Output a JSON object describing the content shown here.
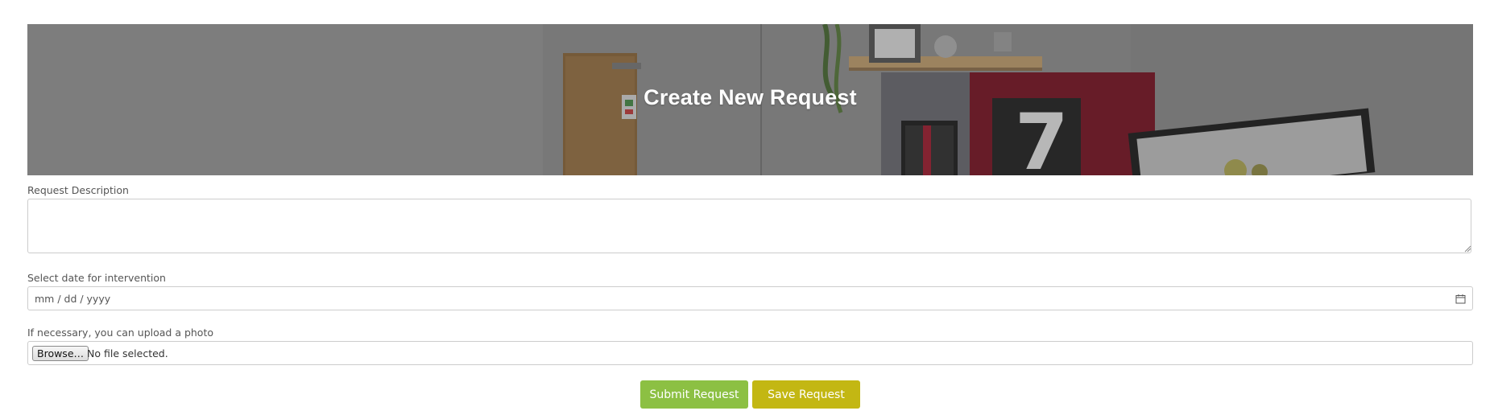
{
  "hero": {
    "title": "Create New Request"
  },
  "form": {
    "description": {
      "label": "Request Description",
      "value": ""
    },
    "date": {
      "label": "Select date for intervention",
      "placeholder": "mm / dd / yyyy"
    },
    "photo": {
      "label": "If necessary, you can upload a photo",
      "browse_label": "Browse…",
      "status": "No file selected."
    }
  },
  "actions": {
    "submit_label": "Submit Request",
    "save_label": "Save Request"
  },
  "colors": {
    "submit": "#8cc043",
    "save": "#c3b713",
    "hero_overlay": "#7f7f7f"
  },
  "icons": {
    "date_picker": "calendar-icon"
  }
}
